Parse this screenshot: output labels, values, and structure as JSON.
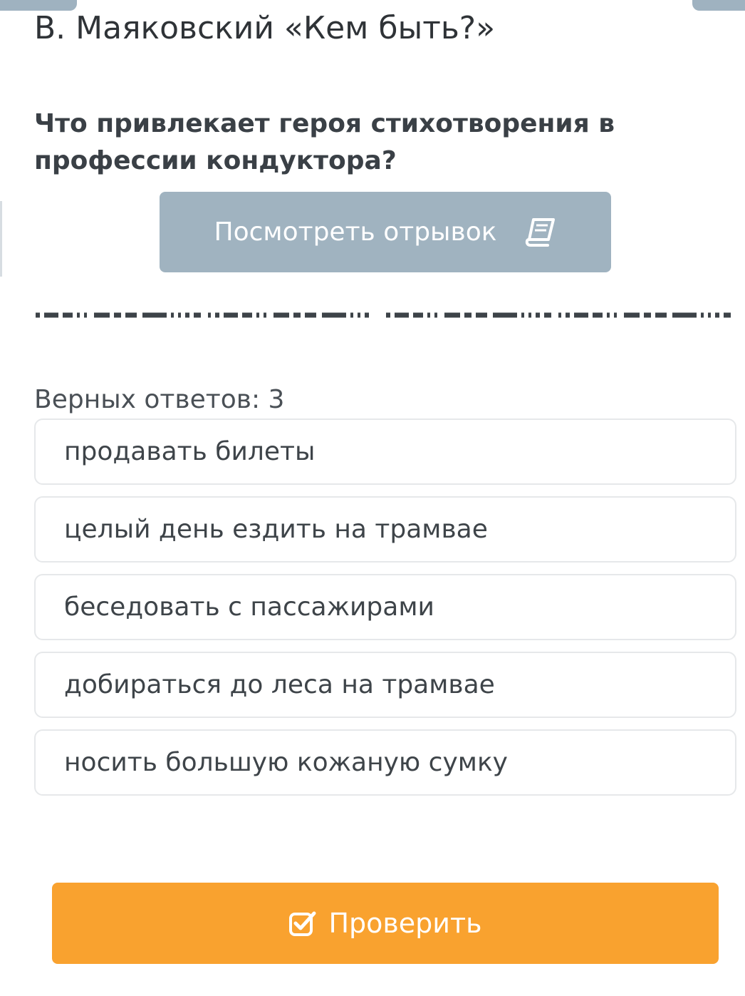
{
  "header": {
    "title": "В. Маяковский «Кем быть?»"
  },
  "question": {
    "text": "Что привлекает героя стихотворения в профессии кондуктора?"
  },
  "excerpt_button": {
    "label": "Посмотреть отрывок",
    "icon": "book-icon"
  },
  "answers": {
    "count_label": "Верных ответов: 3",
    "options": [
      {
        "label": "продавать билеты"
      },
      {
        "label": "целый день ездить на трамвае"
      },
      {
        "label": "беседовать с пассажирами"
      },
      {
        "label": "добираться до леса на трамвае"
      },
      {
        "label": "носить большую кожаную сумку"
      }
    ]
  },
  "check_button": {
    "label": "Проверить",
    "icon": "checkbox-check-icon"
  },
  "colors": {
    "excerpt_button_bg": "#a0b3c0",
    "check_button_bg": "#f9a22f",
    "option_border": "#e6e8ea",
    "text": "#3a3f44"
  }
}
